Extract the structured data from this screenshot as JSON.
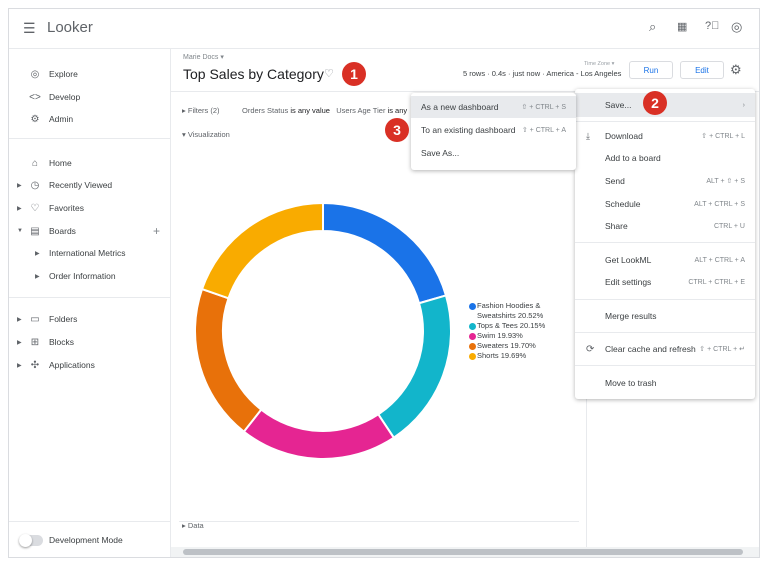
{
  "app": {
    "name": "Looker"
  },
  "sidebar": {
    "items": [
      {
        "label": "Explore",
        "icon": "compass-icon"
      },
      {
        "label": "Develop",
        "icon": "code-icon"
      },
      {
        "label": "Admin",
        "icon": "admin-icon"
      },
      {
        "label": "Home",
        "icon": "home-icon"
      },
      {
        "label": "Recently Viewed",
        "icon": "clock-icon"
      },
      {
        "label": "Favorites",
        "icon": "heart-icon"
      },
      {
        "label": "Boards",
        "icon": "board-icon"
      },
      {
        "label": "International Metrics"
      },
      {
        "label": "Order Information"
      },
      {
        "label": "Folders",
        "icon": "folder-icon"
      },
      {
        "label": "Blocks",
        "icon": "blocks-icon"
      },
      {
        "label": "Applications",
        "icon": "apps-icon"
      }
    ],
    "dev_mode": "Development Mode"
  },
  "header": {
    "breadcrumb": "Marie Docs",
    "title": "Top Sales by Category",
    "meta": "5 rows · 0.4s · just now · America - Los Angeles",
    "timezone_label": "Time Zone",
    "run": "Run",
    "edit": "Edit"
  },
  "filters": {
    "label": "Filters (2)",
    "f1_name": "Orders Status",
    "f1_val": "is any value",
    "f2_name": "Users Age Tier",
    "f2_val": "is any"
  },
  "sections": {
    "visualization": "Visualization",
    "data": "Data"
  },
  "badges": [
    "1",
    "2",
    "3"
  ],
  "gear_menu": {
    "items": [
      {
        "label": "Save...",
        "shortcut": ""
      },
      {
        "label": "Download",
        "shortcut": "⇧ + CTRL + L"
      },
      {
        "label": "Add to a board",
        "shortcut": ""
      },
      {
        "label": "Send",
        "shortcut": "ALT + ⇧ + S"
      },
      {
        "label": "Schedule",
        "shortcut": "ALT + CTRL + S"
      },
      {
        "label": "Share",
        "shortcut": "CTRL + U"
      },
      {
        "label": "Get LookML",
        "shortcut": "ALT + CTRL + A"
      },
      {
        "label": "Edit settings",
        "shortcut": "CTRL + CTRL + E"
      },
      {
        "label": "Merge results",
        "shortcut": ""
      },
      {
        "label": "Clear cache and refresh",
        "shortcut": "⇧ + CTRL + ↵"
      },
      {
        "label": "Move to trash",
        "shortcut": ""
      }
    ]
  },
  "save_submenu": {
    "items": [
      {
        "label": "As a new dashboard",
        "shortcut": "⇧ + CTRL + S"
      },
      {
        "label": "To an existing dashboard",
        "shortcut": "⇧ + CTRL + A"
      },
      {
        "label": "Save As...",
        "shortcut": ""
      }
    ]
  },
  "chart_data": {
    "type": "pie",
    "donut": true,
    "series": [
      {
        "name": "Fashion Hoodies & Sweatshirts",
        "label": "Fashion Hoodies &",
        "label2": "Sweatshirts 20.52%",
        "value": 20.52,
        "color": "#1a73e8"
      },
      {
        "name": "Tops & Tees",
        "label": "Tops & Tees 20.15%",
        "value": 20.15,
        "color": "#12b5cb"
      },
      {
        "name": "Swim",
        "label": "Swim 19.93%",
        "value": 19.93,
        "color": "#e52592"
      },
      {
        "name": "Sweaters",
        "label": "Sweaters 19.70%",
        "value": 19.7,
        "color": "#e8710a"
      },
      {
        "name": "Shorts",
        "label": "Shorts 19.69%",
        "value": 19.69,
        "color": "#f9ab00"
      }
    ],
    "legend": "right"
  }
}
